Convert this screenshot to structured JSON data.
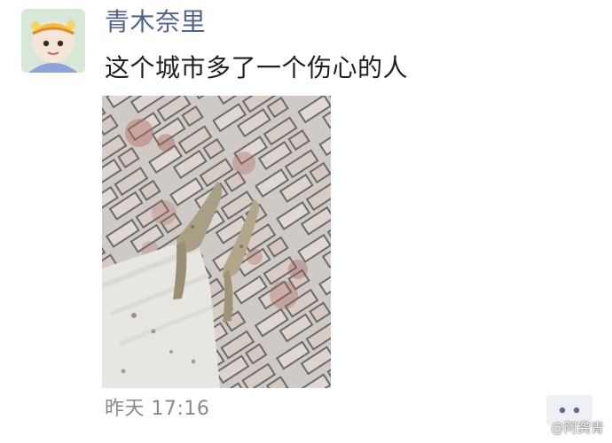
{
  "post": {
    "author": "青木奈里",
    "text": "这个城市多了一个伤心的人",
    "time": "昨天 17:16"
  },
  "icons": {
    "avatar": "avatar-icon",
    "more": "more-options-icon",
    "watermark": "weibo-icon"
  },
  "watermark": {
    "text": "@阿龚青"
  },
  "colors": {
    "author_name": "#53628d",
    "post_text": "#202020",
    "time": "#8a8a8a",
    "more_button_bg": "#eef0f5",
    "more_dots": "#5c6b93"
  }
}
